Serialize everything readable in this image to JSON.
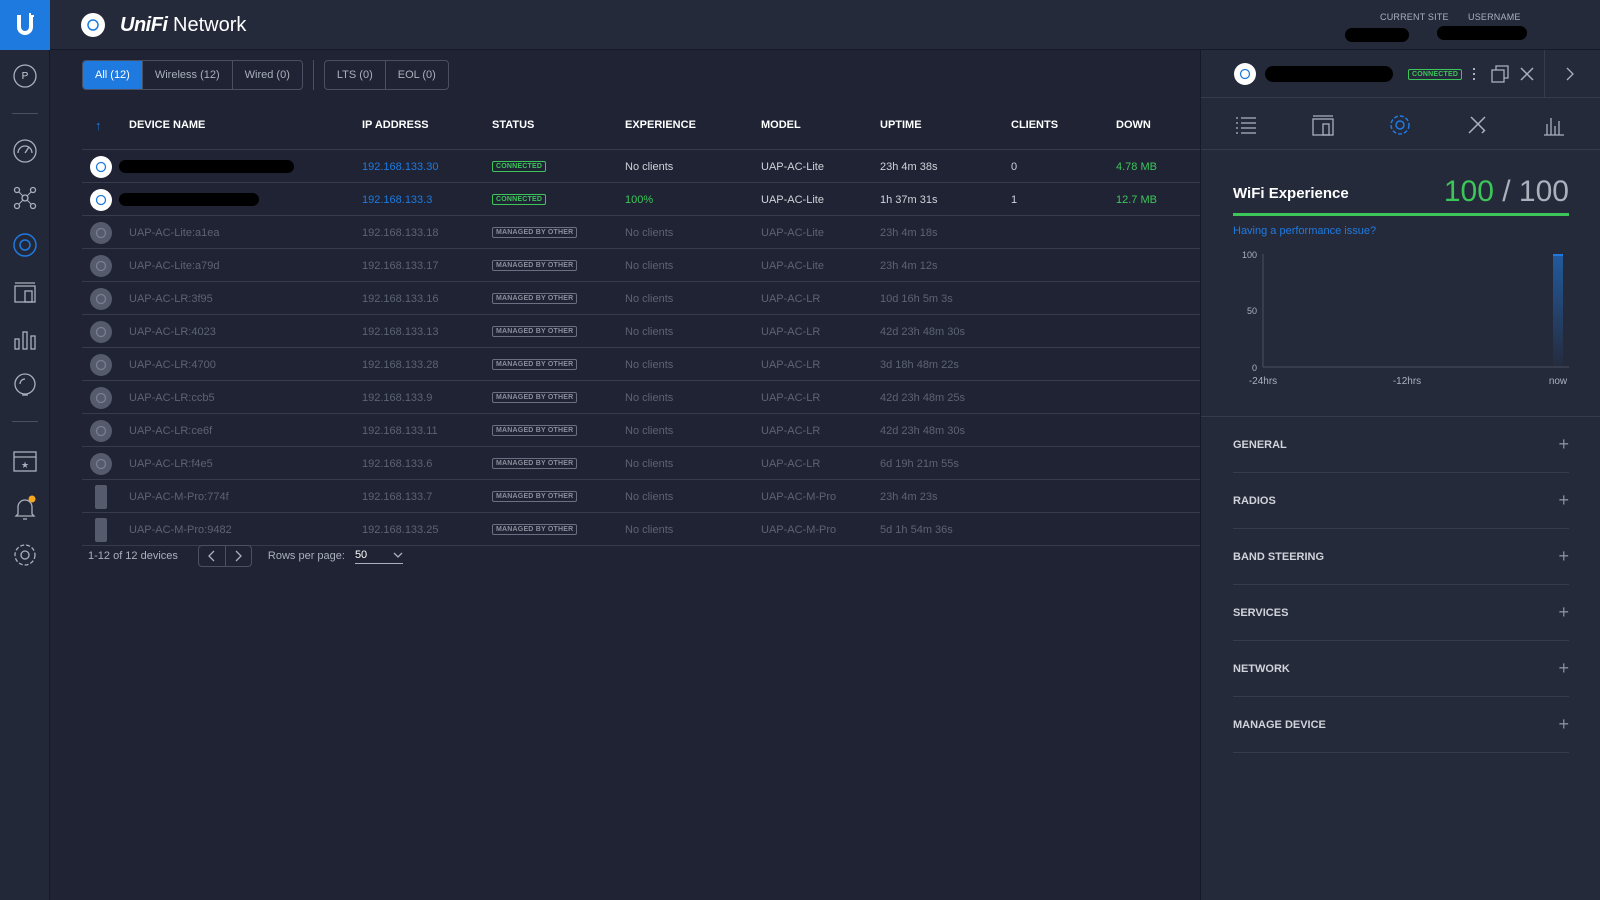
{
  "app": {
    "title_italic": "UniFi",
    "title_rest": " Network"
  },
  "header": {
    "current_site_label": "CURRENT SITE",
    "username_label": "USERNAME"
  },
  "sidebar": {
    "profile_letter": "P"
  },
  "filters": {
    "type_tabs": [
      "All (12)",
      "Wireless (12)",
      "Wired (0)"
    ],
    "status_tabs": [
      "LTS (0)",
      "EOL (0)"
    ],
    "active": "All (12)"
  },
  "table": {
    "sort_indicator": "↑",
    "columns": [
      "DEVICE NAME",
      "IP ADDRESS",
      "STATUS",
      "EXPERIENCE",
      "MODEL",
      "UPTIME",
      "CLIENTS",
      "DOWN"
    ],
    "rows": [
      {
        "name": "",
        "redacted": true,
        "ip": "192.168.133.30",
        "status": "CONNECTED",
        "experience": "No clients",
        "model": "UAP-AC-Lite",
        "uptime": "23h 4m 38s",
        "clients": "0",
        "down": "4.78 MB",
        "state": "active",
        "icon": "ap-round-icon"
      },
      {
        "name": "",
        "redacted": true,
        "ip": "192.168.133.3",
        "status": "CONNECTED",
        "experience": "100%",
        "model": "UAP-AC-Lite",
        "uptime": "1h 37m 31s",
        "clients": "1",
        "down": "12.7 MB",
        "state": "active",
        "icon": "ap-round-icon"
      },
      {
        "name": "UAP-AC-Lite:a1ea",
        "ip": "192.168.133.18",
        "status": "MANAGED BY OTHER",
        "experience": "No clients",
        "model": "UAP-AC-Lite",
        "uptime": "23h 4m 18s",
        "clients": "",
        "down": "",
        "state": "dim",
        "icon": "ap-round-icon"
      },
      {
        "name": "UAP-AC-Lite:a79d",
        "ip": "192.168.133.17",
        "status": "MANAGED BY OTHER",
        "experience": "No clients",
        "model": "UAP-AC-Lite",
        "uptime": "23h 4m 12s",
        "clients": "",
        "down": "",
        "state": "dim",
        "icon": "ap-round-icon"
      },
      {
        "name": "UAP-AC-LR:3f95",
        "ip": "192.168.133.16",
        "status": "MANAGED BY OTHER",
        "experience": "No clients",
        "model": "UAP-AC-LR",
        "uptime": "10d 16h 5m 3s",
        "clients": "",
        "down": "",
        "state": "dim",
        "icon": "ap-round-icon"
      },
      {
        "name": "UAP-AC-LR:4023",
        "ip": "192.168.133.13",
        "status": "MANAGED BY OTHER",
        "experience": "No clients",
        "model": "UAP-AC-LR",
        "uptime": "42d 23h 48m 30s",
        "clients": "",
        "down": "",
        "state": "dim",
        "icon": "ap-round-icon"
      },
      {
        "name": "UAP-AC-LR:4700",
        "ip": "192.168.133.28",
        "status": "MANAGED BY OTHER",
        "experience": "No clients",
        "model": "UAP-AC-LR",
        "uptime": "3d 18h 48m 22s",
        "clients": "",
        "down": "",
        "state": "dim",
        "icon": "ap-round-icon"
      },
      {
        "name": "UAP-AC-LR:ccb5",
        "ip": "192.168.133.9",
        "status": "MANAGED BY OTHER",
        "experience": "No clients",
        "model": "UAP-AC-LR",
        "uptime": "42d 23h 48m 25s",
        "clients": "",
        "down": "",
        "state": "dim",
        "icon": "ap-round-icon"
      },
      {
        "name": "UAP-AC-LR:ce6f",
        "ip": "192.168.133.11",
        "status": "MANAGED BY OTHER",
        "experience": "No clients",
        "model": "UAP-AC-LR",
        "uptime": "42d 23h 48m 30s",
        "clients": "",
        "down": "",
        "state": "dim",
        "icon": "ap-round-icon"
      },
      {
        "name": "UAP-AC-LR:f4e5",
        "ip": "192.168.133.6",
        "status": "MANAGED BY OTHER",
        "experience": "No clients",
        "model": "UAP-AC-LR",
        "uptime": "6d 19h 21m 55s",
        "clients": "",
        "down": "",
        "state": "dim",
        "icon": "ap-round-icon"
      },
      {
        "name": "UAP-AC-M-Pro:774f",
        "ip": "192.168.133.7",
        "status": "MANAGED BY OTHER",
        "experience": "No clients",
        "model": "UAP-AC-M-Pro",
        "uptime": "23h 4m 23s",
        "clients": "",
        "down": "",
        "state": "dim",
        "icon": "ap-mesh-icon"
      },
      {
        "name": "UAP-AC-M-Pro:9482",
        "ip": "192.168.133.25",
        "status": "MANAGED BY OTHER",
        "experience": "No clients",
        "model": "UAP-AC-M-Pro",
        "uptime": "5d 1h 54m 36s",
        "clients": "",
        "down": "",
        "state": "dim",
        "icon": "ap-mesh-icon"
      }
    ]
  },
  "pagination": {
    "summary": "1-12 of 12 devices",
    "rows_per_page_label": "Rows per page:",
    "rows_per_page": "50"
  },
  "panel": {
    "status": "CONNECTED",
    "tabs": [
      "list-icon",
      "device-icon",
      "settings-icon",
      "tools-icon",
      "stats-icon"
    ],
    "wifi_title": "WiFi Experience",
    "score": "100",
    "score_max": "/ 100",
    "perf_link": "Having a performance issue?",
    "chart_y_ticks": [
      "100",
      "50",
      "0"
    ],
    "chart_x_ticks": [
      "-24hrs",
      "-12hrs",
      "now"
    ],
    "sections": [
      "GENERAL",
      "RADIOS",
      "BAND STEERING",
      "SERVICES",
      "NETWORK",
      "MANAGE DEVICE"
    ]
  },
  "colors": {
    "accent": "#1f7ae0",
    "success": "#3cc65a",
    "background": "#1f2333",
    "notification": "#f5a623"
  }
}
